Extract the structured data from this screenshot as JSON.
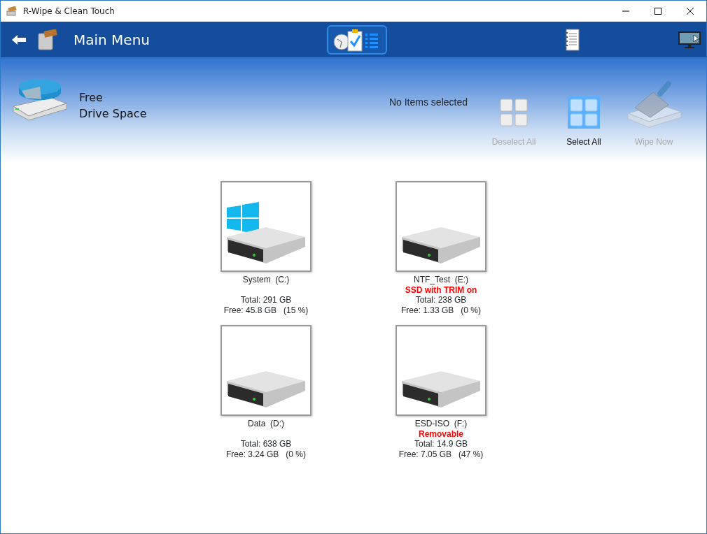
{
  "window": {
    "title": "R-Wipe & Clean Touch"
  },
  "header": {
    "title": "Main Menu",
    "views": [
      {
        "kind": "tasks",
        "selected": true
      },
      {
        "kind": "log",
        "selected": false
      }
    ]
  },
  "section": {
    "title_lines": [
      "Free",
      "Drive Space"
    ],
    "selection_status": "No Items selected"
  },
  "actions": [
    {
      "kind": "deselect",
      "label": "Deselect All",
      "disabled": true
    },
    {
      "kind": "select",
      "label": "Select All",
      "disabled": false
    },
    {
      "kind": "wipe",
      "label": "Wipe Now",
      "disabled": true
    }
  ],
  "drives": [
    {
      "kind": "system",
      "name": "System  (C:)",
      "total": "Total: 291 GB",
      "free": "Free: 45.8 GB   (15 %)"
    },
    {
      "kind": "disk",
      "name": "NTF_Test  (E:)",
      "note": "SSD with TRIM on",
      "total": "Total: 238 GB",
      "free": "Free: 1.33 GB   (0 %)"
    },
    {
      "kind": "disk",
      "name": "Data  (D:)",
      "total": "Total: 638 GB",
      "free": "Free: 3.24 GB   (0 %)"
    },
    {
      "kind": "disk",
      "name": "ESD-ISO  (F:)",
      "note": "Removable",
      "total": "Total: 14.9 GB",
      "free": "Free: 7.05 GB   (47 %)"
    }
  ]
}
